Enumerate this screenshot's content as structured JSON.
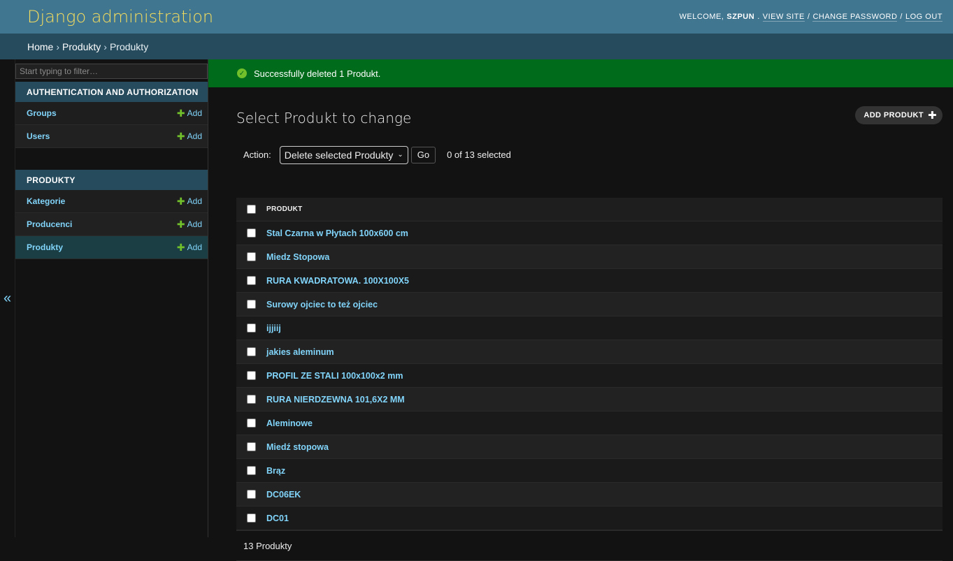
{
  "header": {
    "branding": "Django administration",
    "welcome": "Welcome,",
    "username": "szpun",
    "view_site": "View site",
    "change_password": "Change password",
    "log_out": "Log out",
    "separator": "/"
  },
  "breadcrumbs": {
    "home": "Home",
    "app": "Produkty",
    "current": "Produkty",
    "separator": "›"
  },
  "sidebar": {
    "filter_placeholder": "Start typing to filter…",
    "collapse_glyph": "«",
    "add_label": "Add",
    "modules": [
      {
        "caption": "Authentication and Authorization",
        "models": [
          {
            "name": "Groups"
          },
          {
            "name": "Users"
          }
        ]
      },
      {
        "caption": "Produkty",
        "models": [
          {
            "name": "Kategorie"
          },
          {
            "name": "Producenci"
          },
          {
            "name": "Produkty"
          }
        ]
      }
    ]
  },
  "message": {
    "text": "Successfully deleted 1 Produkt."
  },
  "content": {
    "title": "Select Produkt to change",
    "add_button": "Add Produkt",
    "actions": {
      "label": "Action:",
      "selected_option": "Delete selected Produkty",
      "go": "Go",
      "counter": "0 of 13 selected"
    },
    "table": {
      "column_header": "Produkt",
      "rows": [
        "Stal Czarna w Płytach 100x600 cm",
        "Miedz Stopowa",
        "RURA KWADRATOWA. 100X100X5",
        "Surowy ojciec to też ojciec",
        "ijjiij",
        "jakies aleminum",
        "PROFIL ZE STALI 100x100x2 mm",
        "RURA NIERDZEWNA 101,6X2 MM",
        "Aleminowe",
        "Miedź stopowa",
        "Brąz",
        "DC06EK",
        "DC01"
      ]
    },
    "paginator": "13 Produkty"
  },
  "colors": {
    "header_bg": "#417690",
    "branding": "#f5dd5d",
    "breadcrumbs_bg": "#264b5d",
    "link": "#81d4fa",
    "success_bg": "#006b1b",
    "add_green": "#70bf2b"
  }
}
